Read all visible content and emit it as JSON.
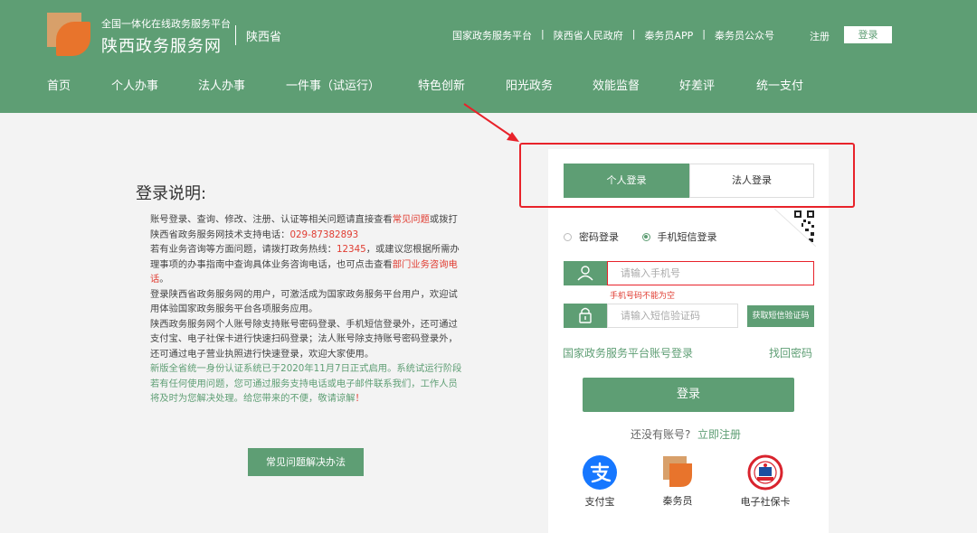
{
  "brand": {
    "subtitle": "全国一体化在线政务服务平台",
    "title": "陕西政务服务网",
    "province": "陕西省"
  },
  "toplinks": [
    "国家政务服务平台",
    "陕西省人民政府",
    "秦务员APP",
    "秦务员公众号"
  ],
  "toplinks_separator": "|",
  "header_register": "注册",
  "header_login": "登录",
  "nav": [
    "首页",
    "个人办事",
    "法人办事",
    "一件事（试运行）",
    "特色创新",
    "阳光政务",
    "效能监督",
    "好差评",
    "统一支付"
  ],
  "info": {
    "title": "登录说明:",
    "p1_a": "账号登录、查询、修改、注册、认证等相关问题请直接查看",
    "p1_link": "常见问题",
    "p1_b": "或拨打陕西省政务服务网技术支持电话：",
    "p1_phone": "029-87382893",
    "p2_a": "若有业务咨询等方面问题，请拨打政务热线：",
    "p2_phone": "12345",
    "p2_b": "，或建议您根据所需办理事项的办事指南中查询具体业务咨询电话，也可点击查看",
    "p2_link": "部门业务咨询电话",
    "p2_c": "。",
    "p3": "登录陕西省政务服务网的用户，可激活成为国家政务服务平台用户，欢迎试用体验国家政务服务平台各项服务应用。",
    "p4": "陕西政务服务网个人账号除支持账号密码登录、手机短信登录外，还可通过支付宝、电子社保卡进行快速扫码登录；法人账号除支持账号密码登录外，还可通过电子营业执照进行快速登录，欢迎大家使用。",
    "p5_a": "新版全省统一身份认证系统已于2020年11月7日正式启用。系统试运行阶段若有任何使用问题，您可通过服务支持电话或电子邮件联系我们，工作人员将及时为您解决处理。给您带来的不便，敬请谅解",
    "p5_b": "！",
    "faq_button": "常见问题解决办法"
  },
  "login": {
    "tab_personal": "个人登录",
    "tab_legal": "法人登录",
    "radio_password": "密码登录",
    "radio_sms": "手机短信登录",
    "phone_placeholder": "请输入手机号",
    "phone_error": "手机号码不能为空",
    "code_placeholder": "请输入短信验证码",
    "get_code": "获取短信验证码",
    "national_login": "国家政务服务平台账号登录",
    "find_password": "找回密码",
    "login_button": "登录",
    "no_account": "还没有账号?",
    "register_now": "立即注册",
    "alt_methods": [
      "支付宝",
      "秦务员",
      "电子社保卡"
    ]
  },
  "colors": {
    "primary": "#5e9e74",
    "highlight_box": "#e8222a",
    "error": "#e03c31"
  }
}
